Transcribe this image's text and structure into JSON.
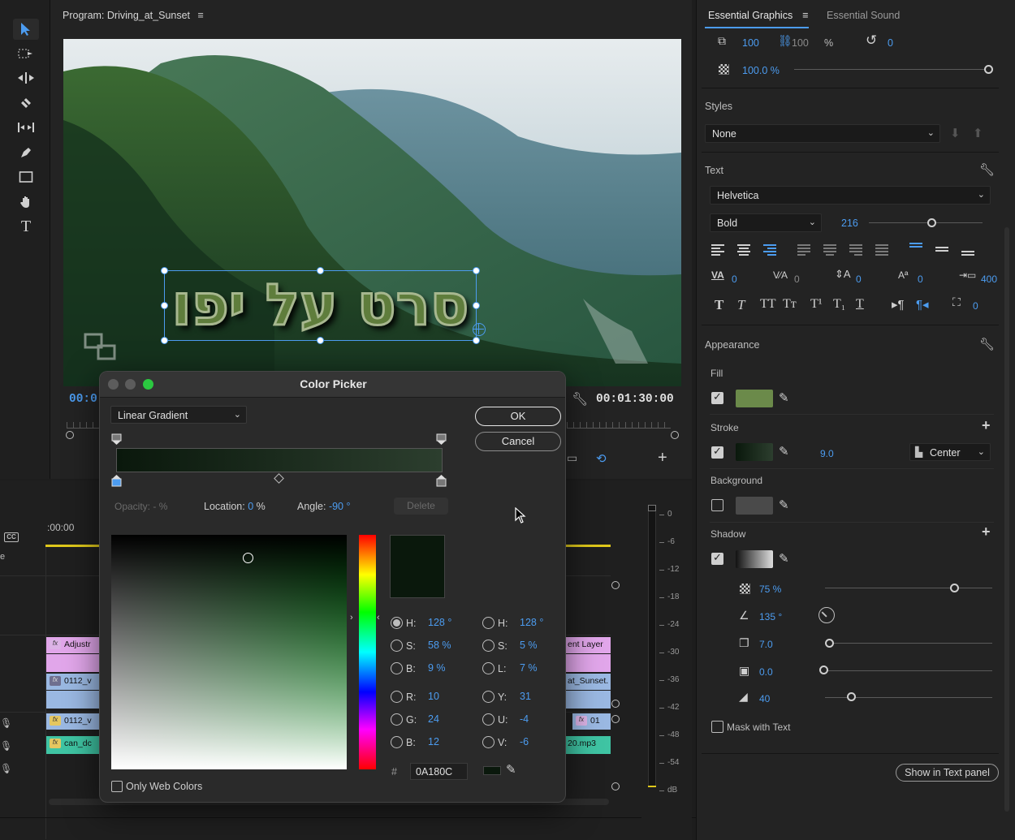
{
  "monitor": {
    "title": "Program: Driving_at_Sunset",
    "title_text": "סרט על יפו",
    "timecode_left": "00:0",
    "timecode_right": "00:01:30:00"
  },
  "timeline": {
    "time_ruler": ":00:00",
    "clips": {
      "adjust_left": "Adjustr",
      "adjust_right": "ent Layer",
      "video_left": "0112_v",
      "video_right": "at_Sunset.",
      "fx_left": "0112_v",
      "fx_right": "01",
      "audio_left": "can_dc",
      "audio_right": "20.mp3"
    }
  },
  "meter": {
    "ticks": [
      "0",
      "-6",
      "-12",
      "-18",
      "-24",
      "-30",
      "-36",
      "-42",
      "-48",
      "-54",
      "dB"
    ]
  },
  "eg": {
    "tabs": {
      "active": "Essential Graphics",
      "other": "Essential Sound"
    },
    "transform": {
      "scale": "100",
      "scale2": "100",
      "percent": "%",
      "rotation": "0",
      "opacity": "100.0 %"
    },
    "styles": {
      "head": "Styles",
      "value": "None"
    },
    "text": {
      "head": "Text",
      "font": "Helvetica",
      "weight": "Bold",
      "size": "216",
      "kerning": "0",
      "tracking": "0",
      "leading": "0",
      "baseline": "0",
      "tsume": "400",
      "indent": "0"
    },
    "appearance": {
      "head": "Appearance",
      "fill": "Fill",
      "stroke": "Stroke",
      "stroke_width": "9.0",
      "stroke_pos": "Center",
      "background": "Background",
      "shadow": "Shadow",
      "shadow_opacity": "75 %",
      "shadow_angle": "135 °",
      "shadow_distance": "7.0",
      "shadow_size": "0.0",
      "shadow_blur": "40",
      "mask": "Mask with Text",
      "show_button": "Show in Text panel"
    }
  },
  "picker": {
    "title": "Color Picker",
    "mode": "Linear Gradient",
    "ok": "OK",
    "cancel": "Cancel",
    "opacity_label": "Opacity:",
    "opacity_value": "- %",
    "location_label": "Location:",
    "location_value": "0",
    "location_unit": "%",
    "angle_label": "Angle:",
    "angle_value": "-90 °",
    "delete": "Delete",
    "hsb": {
      "h_label": "H:",
      "h": "128 °",
      "s_label": "S:",
      "s": "58 %",
      "b_label": "B:",
      "b": "9 %"
    },
    "hsl": {
      "h_label": "H:",
      "h": "128 °",
      "s_label": "S:",
      "s": "5 %",
      "l_label": "L:",
      "l": "7 %"
    },
    "rgb": {
      "r_label": "R:",
      "r": "10",
      "g_label": "G:",
      "g": "24",
      "b_label": "B:",
      "b": "12"
    },
    "yuv": {
      "y_label": "Y:",
      "y": "31",
      "u_label": "U:",
      "u": "-4",
      "v_label": "V:",
      "v": "-6"
    },
    "hash": "#",
    "hex": "0A180C",
    "web_colors": "Only Web Colors"
  },
  "colors": {
    "accent": "#4c9cf0",
    "fill": "#6b8a4a",
    "current": "#0a180c",
    "clip_purple": "#e1a6ea",
    "clip_blue": "#9ab8e2",
    "clip_teal": "#3fc4a3"
  }
}
